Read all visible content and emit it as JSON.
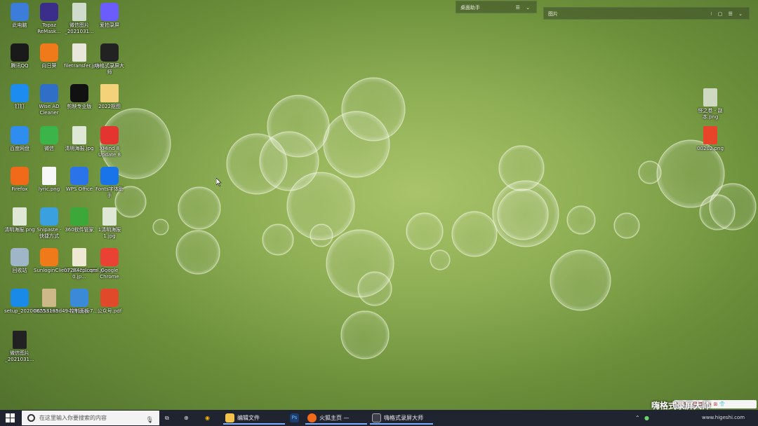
{
  "desktop_icons": [
    {
      "label": "此电脑",
      "icon": "computer-icon",
      "color": "#3b7dd8"
    },
    {
      "label": "Topaz ReMask...",
      "icon": "topaz-icon",
      "color": "#3a2e8a"
    },
    {
      "label": "微信图片_2021031...",
      "icon": "image-file-icon",
      "color": "#cfdccb"
    },
    {
      "label": "爱拍录屏",
      "icon": "aipai-icon",
      "color": "#6a5cff"
    },
    {
      "label": "腾讯QQ",
      "icon": "qq-icon",
      "color": "#1a1a1a"
    },
    {
      "label": "向日葵",
      "icon": "sunflower-icon",
      "color": "#f07a1a"
    },
    {
      "label": "filetransfer.jpg",
      "icon": "image-file-icon",
      "color": "#e9e6dc"
    },
    {
      "label": "嗨格式录屏大师",
      "icon": "recorder-icon",
      "color": "#222"
    },
    {
      "label": "钉钉",
      "icon": "dingtalk-icon",
      "color": "#1d8cf0"
    },
    {
      "label": "Wise AD Cleaner",
      "icon": "shield-icon",
      "color": "#2f6fc8"
    },
    {
      "label": "剪映专业版",
      "icon": "capcut-icon",
      "color": "#111"
    },
    {
      "label": "2022抠图",
      "icon": "folder-icon",
      "color": "#f3d27a"
    },
    {
      "label": "百度网盘",
      "icon": "baidu-netdisk-icon",
      "color": "#2f8df0"
    },
    {
      "label": "微信",
      "icon": "wechat-icon",
      "color": "#3bb54a"
    },
    {
      "label": "清明海报.jpg",
      "icon": "image-file-icon",
      "color": "#dfe8d6"
    },
    {
      "label": "XMind 8 Update 8",
      "icon": "xmind-icon",
      "color": "#e3342f"
    },
    {
      "label": "Firefox",
      "icon": "firefox-icon",
      "color": "#f06a1a"
    },
    {
      "label": "lyric.png",
      "icon": "image-file-icon",
      "color": "#f7f7f7"
    },
    {
      "label": "WPS Office",
      "icon": "wps-icon",
      "color": "#2a73e8"
    },
    {
      "label": "Fonts字体助手",
      "icon": "fonts-icon",
      "color": "#1874e8"
    },
    {
      "label": "清明海报.png",
      "icon": "image-file-icon",
      "color": "#dfe8d6"
    },
    {
      "label": "Snipaste - 快捷方式",
      "icon": "snipaste-icon",
      "color": "#3aa0e0"
    },
    {
      "label": "360软件管家",
      "icon": "360-icon",
      "color": "#3ca83a"
    },
    {
      "label": "1清明海报1.jpg",
      "icon": "image-file-icon",
      "color": "#dfe8d6"
    },
    {
      "label": "回收站",
      "icon": "recycle-bin-icon",
      "color": "#9fb6c8"
    },
    {
      "label": "SunloginClient_10.2.1.exe",
      "icon": "sunflower-icon",
      "color": "#f07a1a"
    },
    {
      "label": "07284cpicqml.jpg-0.jp...",
      "icon": "image-file-icon",
      "color": "#efe8d2"
    },
    {
      "label": "Google Chrome",
      "icon": "chrome-icon",
      "color": "#e94235"
    },
    {
      "label": "setup_20200825a.exe",
      "icon": "setup-icon",
      "color": "#1a8ae8"
    },
    {
      "label": "06553185d494a4124b7...",
      "icon": "image-file-icon",
      "color": "#cdb88a"
    },
    {
      "label": "控制面板",
      "icon": "control-panel-icon",
      "color": "#3a8ad8"
    },
    {
      "label": "公众号.pdf",
      "icon": "pdf-icon",
      "color": "#e04a2a"
    },
    {
      "label": "微信图片_2021031...",
      "icon": "image-file-icon",
      "color": "#222"
    }
  ],
  "right_icons": [
    {
      "label": "怪之卷 - 副本.png",
      "icon": "image-file-icon",
      "color": "#cfd8c0"
    },
    {
      "label": "00202.png",
      "icon": "image-file-icon",
      "color": "#e8442a"
    }
  ],
  "widgets": {
    "assistant_title": "桌面助手",
    "pictures_title": "图片"
  },
  "taskbar": {
    "search_placeholder": "在这里输入你要搜索的内容",
    "apps": [
      {
        "label": "编辑文件",
        "icon": "folder-icon",
        "color": "#f3c34a"
      },
      {
        "label": "",
        "icon": "photoshop-icon",
        "color": "#1c3d6e"
      },
      {
        "label": "火狐主页 — Mozil...",
        "icon": "firefox-icon",
        "color": "#f06a1a"
      },
      {
        "label": "嗨格式录屏大师",
        "icon": "recorder-icon",
        "color": "#3a3f4a"
      }
    ]
  },
  "watermark": "嗨格式录屏大师",
  "site": "www.higeshi.com"
}
